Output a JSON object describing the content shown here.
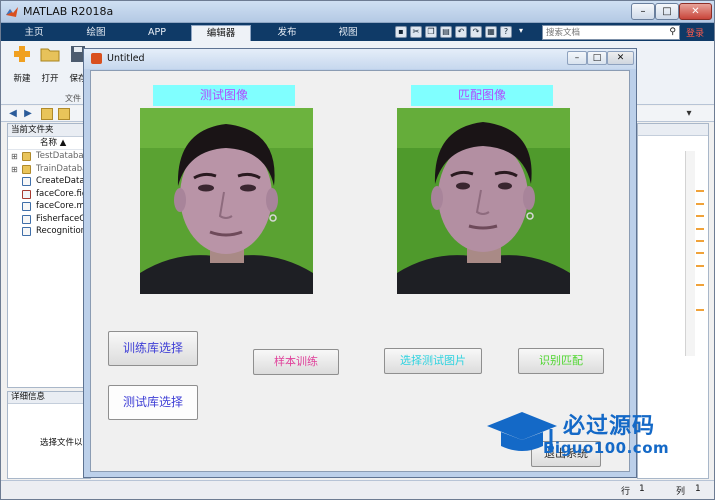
{
  "app": {
    "title": "MATLAB R2018a",
    "tabs": [
      "主页",
      "绘图",
      "APP",
      "编辑器",
      "发布",
      "视图"
    ],
    "active_tab": "编辑器",
    "search_placeholder": "搜索文档",
    "login_label": "登录",
    "window_controls": {
      "minimize": "–",
      "maximize": "□",
      "close": "✕"
    }
  },
  "ribbon": {
    "buttons": [
      {
        "label": "新建",
        "icon": "new-plus-icon"
      },
      {
        "label": "打开",
        "icon": "open-folder-icon"
      },
      {
        "label": "保存",
        "icon": "save-disk-icon"
      }
    ],
    "section_label": "文件"
  },
  "file_panel": {
    "header": "当前文件夹",
    "column_name": "名称 ▲",
    "files": [
      {
        "name": "TestDatabase",
        "type": "folder",
        "expandable": true
      },
      {
        "name": "TrainDatabase",
        "type": "folder",
        "expandable": true
      },
      {
        "name": "CreateDatabase.m",
        "type": "m"
      },
      {
        "name": "faceCore.fig",
        "type": "fig"
      },
      {
        "name": "faceCore.m",
        "type": "m"
      },
      {
        "name": "FisherfaceCore.m",
        "type": "m"
      },
      {
        "name": "Recognition.m",
        "type": "m"
      }
    ]
  },
  "detail_panel": {
    "header": "详细信息",
    "message": "选择文件以查看详细信息"
  },
  "status_bar": {
    "row_label": "行",
    "row_value": "1",
    "col_label": "列",
    "col_value": "1"
  },
  "figure": {
    "title": "Untitled",
    "controls": {
      "minimize": "–",
      "maximize": "□",
      "close": "✕"
    },
    "test_image_title": "测试图像",
    "match_image_title": "匹配图像",
    "buttons": {
      "train_lib": "训练库选择",
      "test_lib": "测试库选择",
      "sample_train": "样本训练",
      "select_test": "选择测试图片",
      "recognize": "识别匹配",
      "exit": "退出系统"
    },
    "button_colors": {
      "train_lib": "#3f3fd6",
      "test_lib": "#3f3fd6",
      "sample_train": "#e0409a",
      "select_test": "#2fd3e0",
      "recognize": "#4fd62f",
      "exit": "#333333"
    }
  },
  "watermark": {
    "text": "必过源码",
    "url": "Biguo100.com"
  }
}
